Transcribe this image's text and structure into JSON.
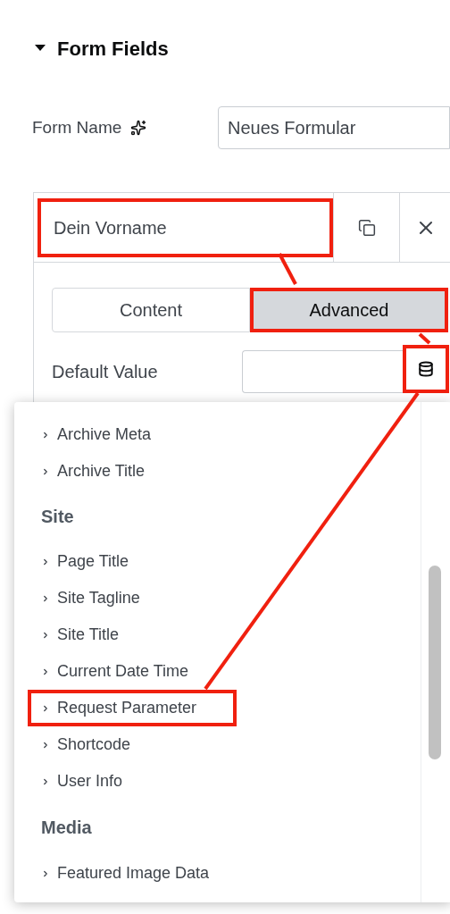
{
  "section": {
    "title": "Form Fields",
    "expanded": true
  },
  "form_name": {
    "label": "Form Name",
    "value": "Neues Formular"
  },
  "repeater_item": {
    "title": "Dein Vorname",
    "highlighted": true,
    "tabs": [
      {
        "label": "Content",
        "selected": false,
        "highlighted": false
      },
      {
        "label": "Advanced",
        "selected": true,
        "highlighted": true
      }
    ],
    "default_value": {
      "label": "Default Value",
      "dynamic_button_highlighted": true
    }
  },
  "dropdown": {
    "items": [
      {
        "kind": "item",
        "label": "Archive Meta",
        "highlighted": false
      },
      {
        "kind": "item",
        "label": "Archive Title",
        "highlighted": false
      },
      {
        "kind": "heading",
        "label": "Site"
      },
      {
        "kind": "item",
        "label": "Page Title",
        "highlighted": false
      },
      {
        "kind": "item",
        "label": "Site Tagline",
        "highlighted": false
      },
      {
        "kind": "item",
        "label": "Site Title",
        "highlighted": false
      },
      {
        "kind": "item",
        "label": "Current Date Time",
        "highlighted": false
      },
      {
        "kind": "item",
        "label": "Request Parameter",
        "highlighted": true
      },
      {
        "kind": "item",
        "label": "Shortcode",
        "highlighted": false
      },
      {
        "kind": "item",
        "label": "User Info",
        "highlighted": false
      },
      {
        "kind": "heading",
        "label": "Media"
      },
      {
        "kind": "item",
        "label": "Featured Image Data",
        "highlighted": false
      }
    ]
  }
}
